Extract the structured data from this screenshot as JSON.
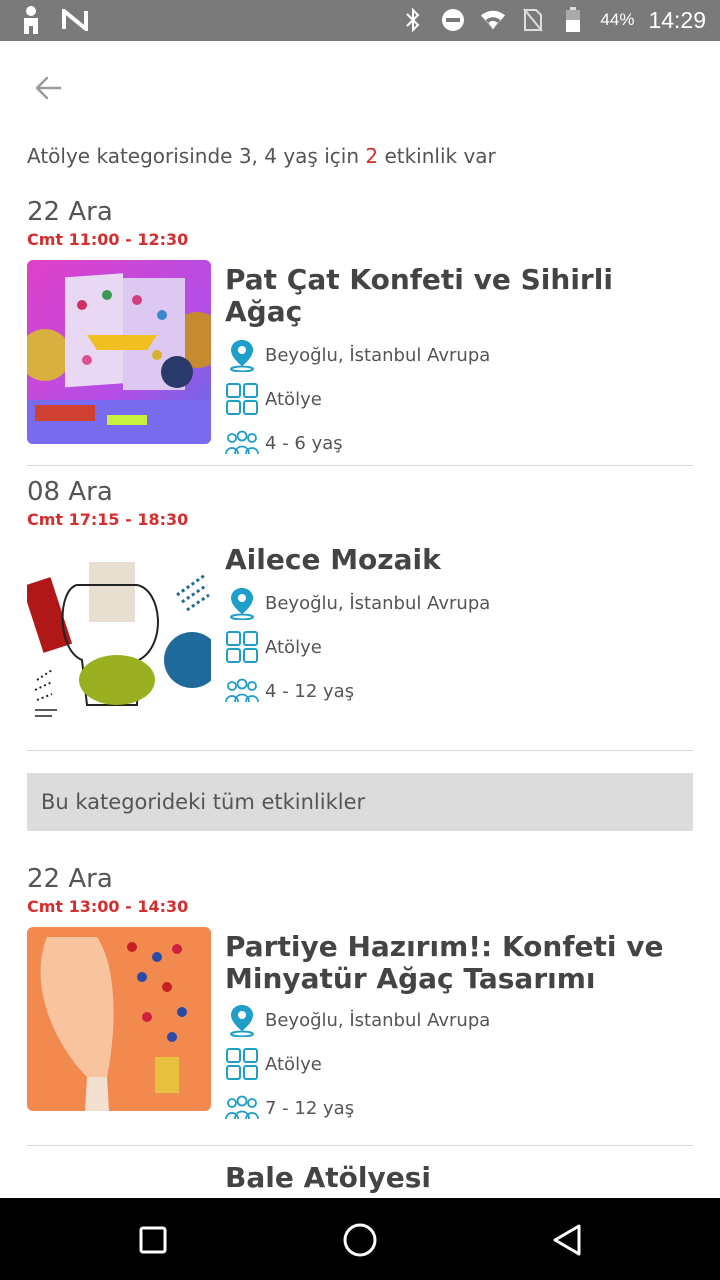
{
  "status_bar": {
    "battery": "44%",
    "time": "14:29",
    "icons": [
      "person-icon",
      "n-logo-icon",
      "bluetooth-icon",
      "dnd-icon",
      "wifi-icon",
      "no-sim-icon",
      "battery-icon"
    ]
  },
  "header": {
    "back_icon": "arrow-left-icon"
  },
  "summary": {
    "prefix": "Atölye kategorisinde 3, 4 yaş için",
    "count": "2",
    "suffix": "etkinlik var"
  },
  "events": [
    {
      "date": "22 Ara",
      "time": "Cmt 11:00 - 12:30",
      "title": "Pat Çat Konfeti ve Sihirli Ağaç",
      "location": "Beyoğlu, İstanbul Avrupa",
      "category": "Atölye",
      "age": "4 - 6 yaş"
    },
    {
      "date": "08 Ara",
      "time": "Cmt 17:15 - 18:30",
      "title": "Ailece Mozaik",
      "location": "Beyoğlu, İstanbul Avrupa",
      "category": "Atölye",
      "age": "4 - 12 yaş"
    }
  ],
  "all_category_label": "Bu kategorideki tüm etkinlikler",
  "more_events": [
    {
      "date": "22 Ara",
      "time": "Cmt 13:00 - 14:30",
      "title_line1": "Partiye Hazırım!: Konfeti ve",
      "title_line2": "Minyatür Ağaç Tasarımı",
      "location": "Beyoğlu, İstanbul Avrupa",
      "category": "Atölye",
      "age": "7 - 12 yaş"
    },
    {
      "title": "Bale Atölyesi"
    }
  ],
  "colors": {
    "accent_red": "#d32f2f",
    "icon_blue": "#1e9ec8"
  },
  "nav": {
    "icons": [
      "square-recent-icon",
      "circle-home-icon",
      "triangle-back-icon"
    ]
  }
}
